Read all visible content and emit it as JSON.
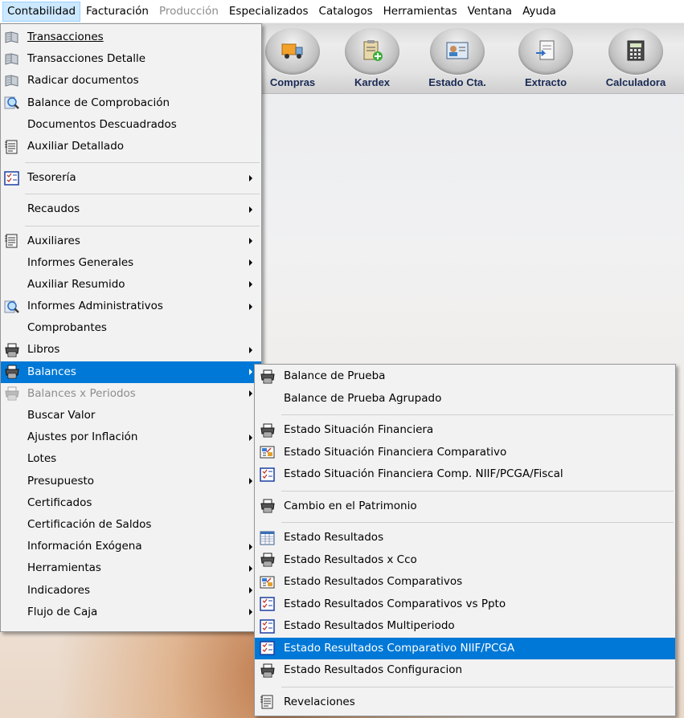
{
  "menubar": {
    "items": [
      "Contabilidad",
      "Facturación",
      "Producción",
      "Especializados",
      "Catalogos",
      "Herramientas",
      "Ventana",
      "Ayuda"
    ]
  },
  "toolbar": {
    "buttons": [
      {
        "label": "Compras",
        "icon": "truck-icon"
      },
      {
        "label": "Kardex",
        "icon": "clipboard-add-icon"
      },
      {
        "label": "Estado Cta.",
        "icon": "id-card-icon"
      },
      {
        "label": "Extracto",
        "icon": "document-arrow-icon"
      },
      {
        "label": "Calculadora",
        "icon": "calculator-icon"
      }
    ]
  },
  "main_menu": {
    "items": [
      {
        "label": "Transacciones",
        "icon": "book-icon"
      },
      {
        "label": "Transacciones Detalle",
        "icon": "book-icon"
      },
      {
        "label": "Radicar documentos",
        "icon": "book-icon"
      },
      {
        "label": "Balance de Comprobación",
        "icon": "magnifier-icon"
      },
      {
        "label": "Documentos Descuadrados",
        "icon": ""
      },
      {
        "label": "Auxiliar Detallado",
        "icon": "ledger-icon"
      },
      {
        "label": "Tesorería",
        "icon": "checklist-icon",
        "submenu": true
      },
      {
        "label": "Recaudos",
        "icon": "",
        "submenu": true
      },
      {
        "label": "Auxiliares",
        "icon": "ledger-icon",
        "submenu": true
      },
      {
        "label": "Informes Generales",
        "icon": "",
        "submenu": true
      },
      {
        "label": "Auxiliar Resumido",
        "icon": "",
        "submenu": true
      },
      {
        "label": "Informes Administrativos",
        "icon": "magnifier-icon",
        "submenu": true
      },
      {
        "label": "Comprobantes",
        "icon": ""
      },
      {
        "label": "Libros",
        "icon": "printer-icon",
        "submenu": true
      },
      {
        "label": "Balances",
        "icon": "printer-icon",
        "submenu": true,
        "selected": true
      },
      {
        "label": "Balances x Periodos",
        "icon": "printer-icon",
        "submenu": true,
        "disabled": true
      },
      {
        "label": "Buscar Valor",
        "icon": ""
      },
      {
        "label": "Ajustes por Inflación",
        "icon": "",
        "submenu": true
      },
      {
        "label": "Lotes",
        "icon": ""
      },
      {
        "label": "Presupuesto",
        "icon": "",
        "submenu": true
      },
      {
        "label": "Certificados",
        "icon": ""
      },
      {
        "label": "Certificación de Saldos",
        "icon": ""
      },
      {
        "label": "Información Exógena",
        "icon": "",
        "submenu": true
      },
      {
        "label": "Herramientas",
        "icon": "",
        "submenu": true
      },
      {
        "label": "Indicadores",
        "icon": "",
        "submenu": true
      },
      {
        "label": "Flujo de Caja",
        "icon": "",
        "submenu": true
      }
    ]
  },
  "sub_menu": {
    "items": [
      {
        "label": "Balance de Prueba",
        "icon": "printer-icon"
      },
      {
        "label": "Balance de Prueba Agrupado",
        "icon": ""
      },
      {
        "label": "Estado Situación Financiera",
        "icon": "printer-icon"
      },
      {
        "label": "Estado Situación Financiera Comparativo",
        "icon": "compare-icon"
      },
      {
        "label": "Estado Situación Financiera Comp. NIIF/PCGA/Fiscal",
        "icon": "checklist-icon"
      },
      {
        "label": "Cambio en el Patrimonio",
        "icon": "printer-icon"
      },
      {
        "label": "Estado Resultados",
        "icon": "spreadsheet-icon"
      },
      {
        "label": "Estado Resultados x Cco",
        "icon": "printer-icon"
      },
      {
        "label": "Estado Resultados Comparativos",
        "icon": "compare-icon"
      },
      {
        "label": "Estado Resultados Comparativos vs Ppto",
        "icon": "checklist-icon"
      },
      {
        "label": "Estado Resultados Multiperiodo",
        "icon": "checklist-icon"
      },
      {
        "label": "Estado Resultados Comparativo NIIF/PCGA",
        "icon": "checklist-icon",
        "highlighted": true
      },
      {
        "label": "Estado Resultados Configuracion",
        "icon": "printer-icon"
      },
      {
        "label": "Revelaciones",
        "icon": "ledger-icon"
      }
    ]
  },
  "colors": {
    "highlight": "#0078d7",
    "menubar_active": "#cce8ff",
    "menu_background": "#f2f2f2",
    "toolbar_label": "#1a2a55"
  }
}
